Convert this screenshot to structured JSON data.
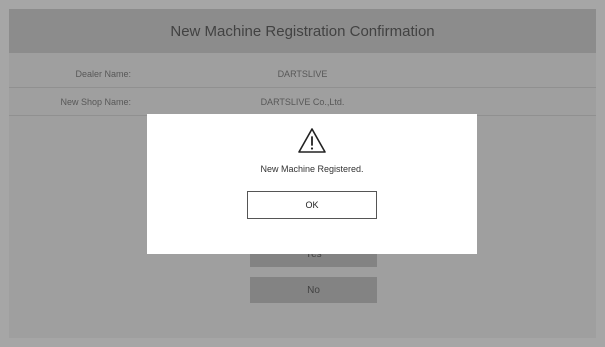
{
  "screen": {
    "title": "New Machine Registration Confirmation",
    "fields": [
      {
        "label": "Dealer Name:",
        "value": "DARTSLIVE"
      },
      {
        "label": "New Shop Name:",
        "value": "DARTSLIVE Co.,Ltd."
      }
    ],
    "yes_label": "Yes",
    "no_label": "No"
  },
  "dialog": {
    "icon": "warning-triangle-icon",
    "message": "New Machine Registered.",
    "ok_label": "OK"
  },
  "colors": {
    "overlay": "#000000",
    "title_bar": "#d8d8d8",
    "button_bg": "#c9c9c9"
  }
}
